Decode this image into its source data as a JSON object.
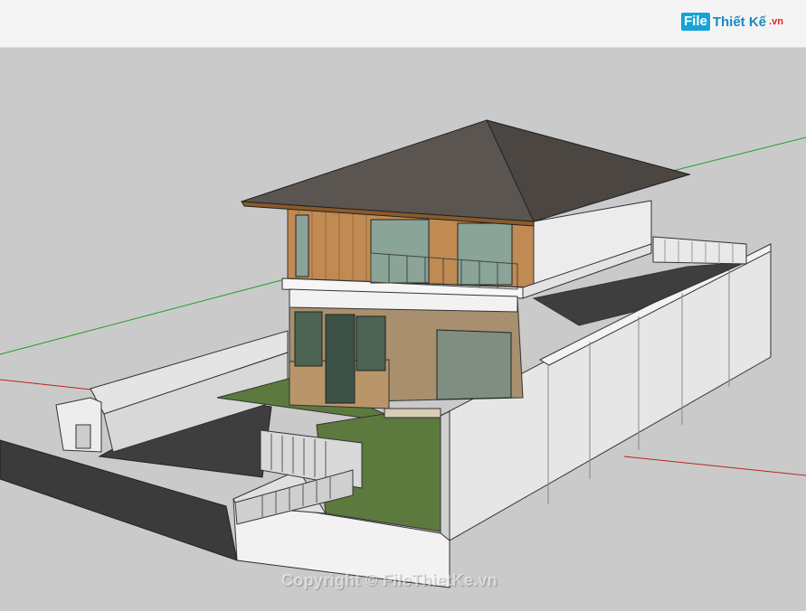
{
  "header": {
    "logo_box": "File",
    "logo_text": "Thiết Kế",
    "logo_suffix": ".vn"
  },
  "watermark": "Copyright © FileThietKe.vn",
  "colors": {
    "background": "#cacaca",
    "roof": "#5a5550",
    "wall": "#e7e7e7",
    "grass": "#5c7a3e",
    "driveway": "#3e3e3e",
    "axis_green": "#1e9e1e",
    "axis_red": "#c02020"
  }
}
